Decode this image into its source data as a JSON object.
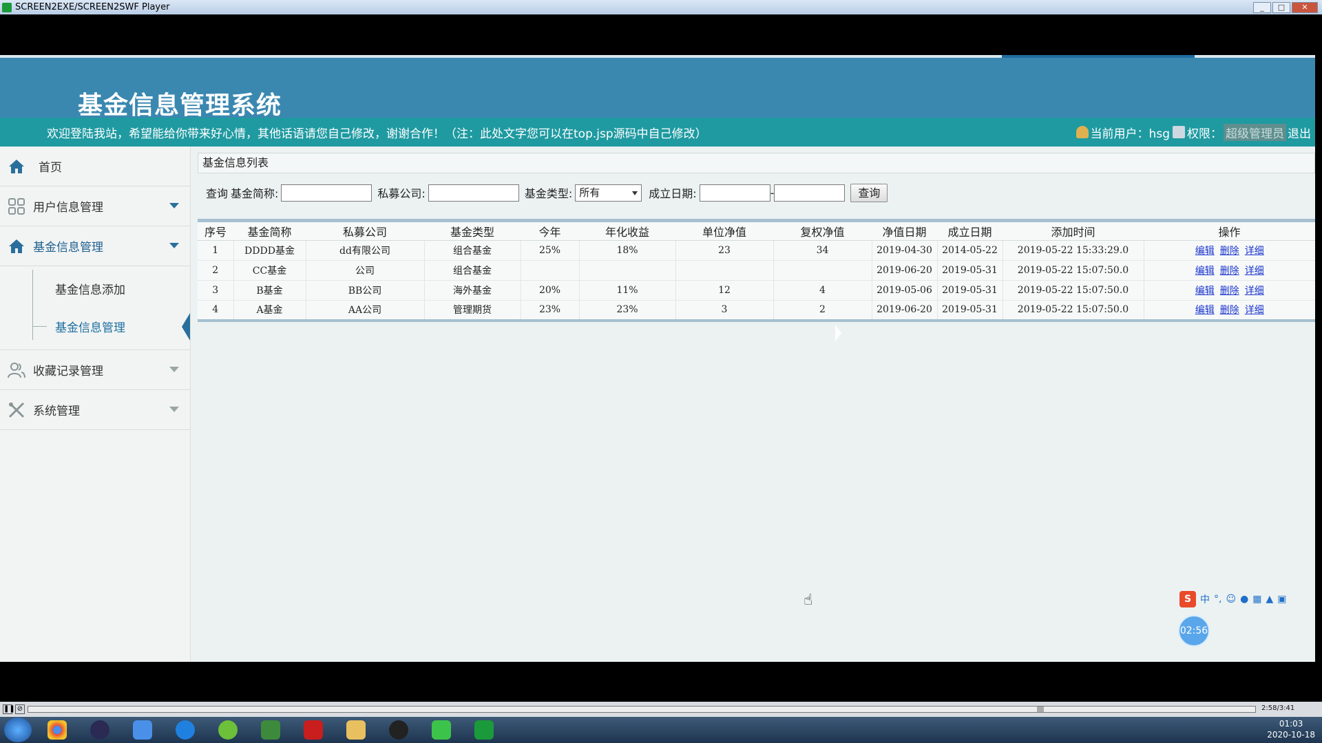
{
  "window": {
    "title": "SCREEN2EXE/SCREEN2SWF Player"
  },
  "header": {
    "system_title": "基金信息管理系统",
    "welcome": "欢迎登陆我站，希望能给你带来好心情，其他话语请您自己修改，谢谢合作！（注：此处文字您可以在top.jsp源码中自己修改）",
    "current_user_label": "当前用户：hsg",
    "permission_label": "权限：",
    "role": "超级管理员",
    "logout": "退出"
  },
  "sidebar": {
    "home": "首页",
    "user_mgmt": "用户信息管理",
    "fund_mgmt": "基金信息管理",
    "fund_add": "基金信息添加",
    "fund_manage": "基金信息管理",
    "favorites": "收藏记录管理",
    "system": "系统管理"
  },
  "panel": {
    "title": "基金信息列表"
  },
  "search": {
    "query_label": "查询",
    "fund_name_label": "基金简称:",
    "company_label": "私募公司:",
    "type_label": "基金类型:",
    "type_value": "所有",
    "date_label": "成立日期:",
    "date_sep": "-",
    "button": "查询"
  },
  "table": {
    "headers": [
      "序号",
      "基金简称",
      "私募公司",
      "基金类型",
      "今年",
      "年化收益",
      "单位净值",
      "复权净值",
      "净值日期",
      "成立日期",
      "添加时间",
      "操作"
    ],
    "actions": {
      "edit": "编辑",
      "delete": "删除",
      "detail": "详细"
    },
    "rows": [
      [
        "1",
        "DDDD基金",
        "dd有限公司",
        "组合基金",
        "25%",
        "18%",
        "23",
        "34",
        "2019-04-30",
        "2014-05-22",
        "2019-05-22 15:33:29.0"
      ],
      [
        "2",
        "CC基金",
        "公司",
        "组合基金",
        "",
        "",
        "",
        "",
        "2019-06-20",
        "2019-05-31",
        "2019-05-22 15:07:50.0"
      ],
      [
        "3",
        "B基金",
        "BB公司",
        "海外基金",
        "20%",
        "11%",
        "12",
        "4",
        "2019-05-06",
        "2019-05-31",
        "2019-05-22 15:07:50.0"
      ],
      [
        "4",
        "A基金",
        "AA公司",
        "管理期货",
        "23%",
        "23%",
        "3",
        "2",
        "2019-06-20",
        "2019-05-31",
        "2019-05-22 15:07:50.0"
      ]
    ]
  },
  "overlay": {
    "ime_label": "中",
    "timer": "02:56"
  },
  "player": {
    "time": "2:58/3:41"
  },
  "taskbar": {
    "time": "01:03",
    "date": "2020-10-18"
  }
}
